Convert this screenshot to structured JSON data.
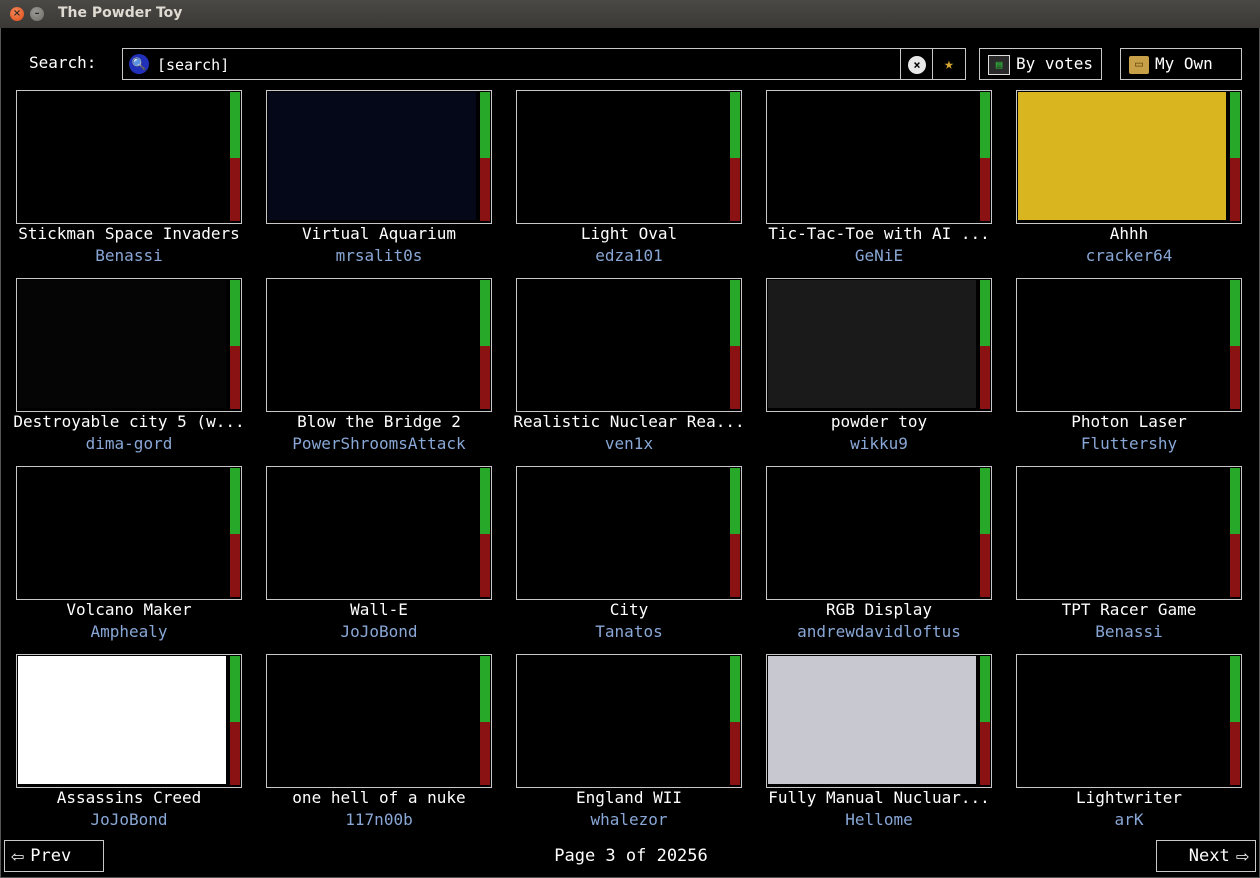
{
  "window": {
    "title": "The Powder Toy",
    "close_glyph": "×",
    "min_glyph": "–"
  },
  "search": {
    "label": "Search:",
    "value": "[search]",
    "icon": "🔍",
    "clear_glyph": "×",
    "fav_glyph": "★"
  },
  "toolbar": {
    "by_votes_label": "By votes",
    "by_votes_icon": "▤",
    "my_own_label": "My Own",
    "my_own_icon": "▭"
  },
  "saves": [
    {
      "title": "Stickman Space Invaders",
      "author": "Benassi",
      "bg": "#000000"
    },
    {
      "title": "Virtual Aquarium",
      "author": "mrsalit0s",
      "bg": "#040818"
    },
    {
      "title": "Light Oval",
      "author": "edza101",
      "bg": "#000000"
    },
    {
      "title": "Tic-Tac-Toe with AI ...",
      "author": "GeNiE",
      "bg": "#000000"
    },
    {
      "title": "Ahhh",
      "author": "cracker64",
      "bg": "#d9b51f"
    },
    {
      "title": "Destroyable city 5 (w...",
      "author": "dima-gord",
      "bg": "#050505"
    },
    {
      "title": "Blow the Bridge 2",
      "author": "PowerShroomsAttack",
      "bg": "#000000"
    },
    {
      "title": "Realistic Nuclear Rea...",
      "author": "ven1x",
      "bg": "#000000"
    },
    {
      "title": "powder toy",
      "author": "wikku9",
      "bg": "#1a1a1a"
    },
    {
      "title": "Photon Laser",
      "author": "Fluttershy",
      "bg": "#000000"
    },
    {
      "title": "Volcano Maker",
      "author": "Amphealy",
      "bg": "#000000"
    },
    {
      "title": "Wall-E",
      "author": "JoJoBond",
      "bg": "#000000"
    },
    {
      "title": "City",
      "author": "Tanatos",
      "bg": "#000000"
    },
    {
      "title": "RGB Display",
      "author": "andrewdavidloftus",
      "bg": "#000000"
    },
    {
      "title": "TPT Racer Game",
      "author": "Benassi",
      "bg": "#000000"
    },
    {
      "title": "Assassins Creed",
      "author": "JoJoBond",
      "bg": "#ffffff"
    },
    {
      "title": "one hell of a nuke",
      "author": "117n00b",
      "bg": "#000000"
    },
    {
      "title": "England WII",
      "author": "whalezor",
      "bg": "#000000"
    },
    {
      "title": "Fully Manual Nucluar...",
      "author": "Hellome",
      "bg": "#c8c8d0"
    },
    {
      "title": "Lightwriter",
      "author": "arK",
      "bg": "#000000"
    }
  ],
  "pagination": {
    "prev_label": "Prev",
    "next_label": "Next",
    "page_text": "Page 3 of 20256",
    "prev_arrow": "⇦",
    "next_arrow": "⇨"
  }
}
